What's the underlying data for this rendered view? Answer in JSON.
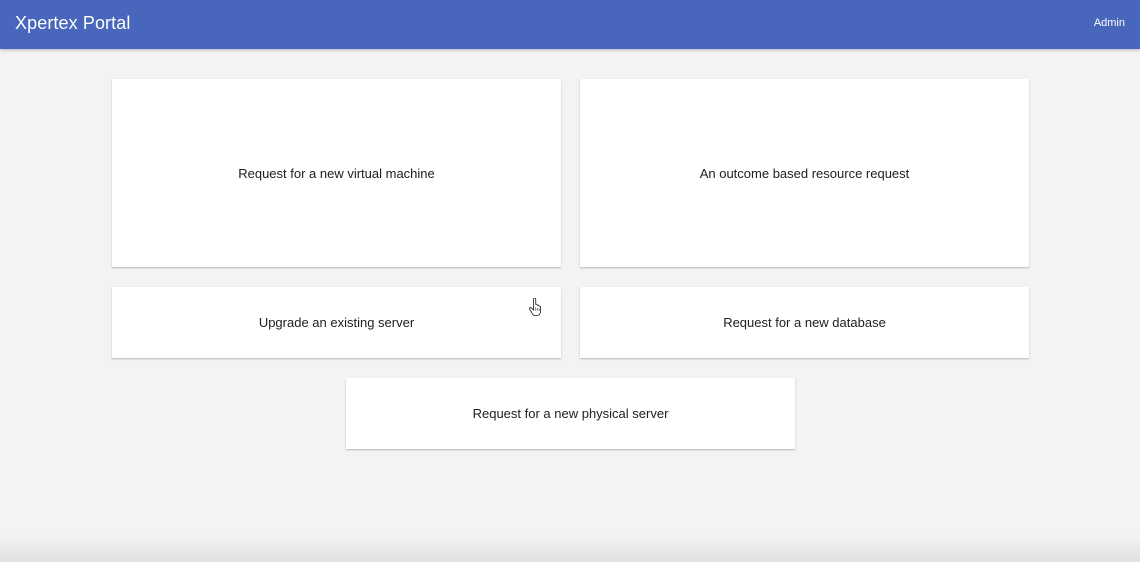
{
  "header": {
    "title": "Xpertex Portal",
    "user": "Admin",
    "color": "#4866bb"
  },
  "cards": [
    {
      "label": "Request for a new virtual machine"
    },
    {
      "label": "An outcome based resource request"
    },
    {
      "label": "Upgrade an existing server"
    },
    {
      "label": "Request for a new database"
    },
    {
      "label": "Request for a new physical server"
    }
  ],
  "cursor": {
    "icon": "hand-pointer-icon"
  }
}
